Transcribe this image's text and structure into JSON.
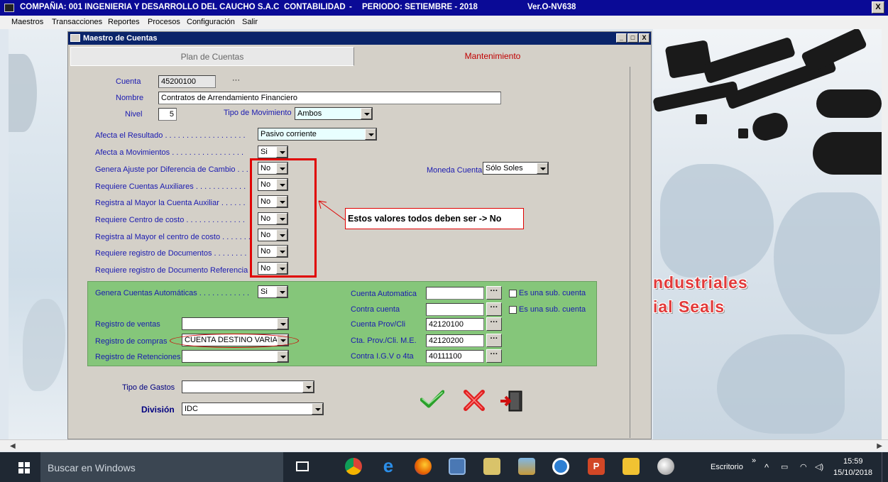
{
  "app": {
    "title_company": "COMPAÑIA:  001 INGENIERIA Y DESARROLLO DEL CAUCHO S.A.C",
    "title_module": "CONTABILIDAD",
    "title_sep": "-",
    "title_period": "PERIODO: SETIEMBRE - 2018",
    "version": "Ver.O-NV638",
    "window_controls": [
      "_",
      "□",
      "X"
    ]
  },
  "menu": [
    "Maestros",
    "Transacciones",
    "Reportes",
    "Procesos",
    "Configuración",
    "Salir"
  ],
  "background_text": [
    "ndustriales",
    "ial Seals"
  ],
  "dialog": {
    "title": "Maestro de Cuentas",
    "tabs": [
      "Plan de Cuentas",
      "Mantenimiento"
    ],
    "cuenta_label": "Cuenta",
    "cuenta_value": "45200100",
    "ellipsis": "···",
    "nombre_label": "Nombre",
    "nombre_value": "Contratos de Arrendamiento Financiero",
    "nivel_label": "Nivel",
    "nivel_value": "5",
    "tipo_mov_label": "Tipo de Movimiento",
    "tipo_mov_value": "Ambos",
    "afecta_resultado_label": "Afecta el  Resultado",
    "afecta_resultado_dots": " . . . . . . . . . . . . . . . . . . .",
    "afecta_resultado_value": "Pasivo corriente",
    "afecta_mov_label": "Afecta a Movimientos",
    "afecta_mov_dots": " . . . . . . . . . . . . . . . . .",
    "afecta_mov_value": "Si",
    "flags": [
      {
        "label": "Genera Ajuste por Diferencia de Cambio",
        "dots": " . . .",
        "value": "No"
      },
      {
        "label": "Requiere Cuentas Auxiliares",
        "dots": " . . . . . . . . . . . .",
        "value": "No"
      },
      {
        "label": "Registra al Mayor la Cuenta Auxiliar",
        "dots": " . . . . . .",
        "value": "No"
      },
      {
        "label": "Requiere Centro de costo",
        "dots": " . . . . . . . . . . . . . .",
        "value": "No"
      },
      {
        "label": "Registra al Mayor el centro de costo",
        "dots": " . . . . . . .",
        "value": "No"
      },
      {
        "label": "Requiere registro de Documentos",
        "dots": " . . . . . . . .",
        "value": "No"
      },
      {
        "label": "Requiere registro de Documento Referencia",
        "dots": " .",
        "value": "No"
      }
    ],
    "moneda_label": "Moneda Cuenta",
    "moneda_value": "Sólo Soles",
    "callout_text": "Estos valores todos deben ser -> No",
    "green": {
      "genera_label": "Genera Cuentas Automáticas",
      "genera_dots": " . . . . . . . . . . . .",
      "genera_value": "Si",
      "reg_ventas_label": "Registro de ventas",
      "reg_ventas_value": "",
      "reg_compras_label": "Registro de compras",
      "reg_compras_value": "CUENTA DESTINO VARIABLE",
      "reg_ret_label": "Registro de Retenciones",
      "reg_ret_value": "",
      "cuenta_auto_label": "Cuenta Automatica",
      "cuenta_auto_value": "",
      "contra_label": "Contra cuenta",
      "contra_value": "",
      "sub_cuenta_label": "Es una sub. cuenta",
      "prov_label": "Cuenta Prov/Cli",
      "prov_value": "42120100",
      "prov_me_label": "Cta. Prov./Cli. M.E.",
      "prov_me_value": "42120200",
      "igv_label": "Contra I.G.V o 4ta",
      "igv_value": "40111100"
    },
    "tipo_gastos_label": "Tipo de Gastos",
    "tipo_gastos_value": "",
    "division_label": "División",
    "division_value": "IDC"
  },
  "taskbar": {
    "search_placeholder": "Buscar en Windows",
    "desktop_label": "Escritorio",
    "chevrons": "»",
    "time": "15:59",
    "date": "15/10/2018"
  }
}
